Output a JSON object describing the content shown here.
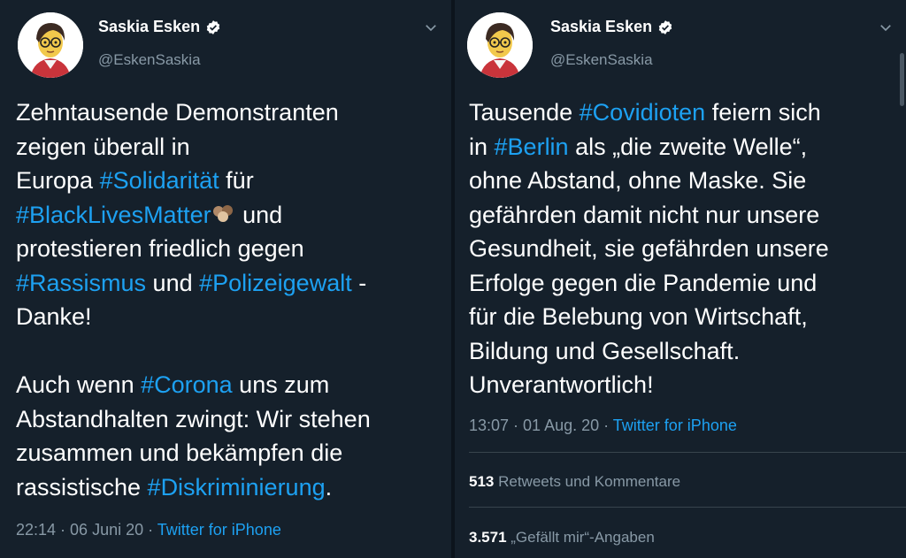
{
  "left_tweet": {
    "author": {
      "name": "Saskia Esken",
      "handle": "@EskenSaskia"
    },
    "lines": [
      {
        "segments": [
          {
            "text": "Zehntausende Demonstranten",
            "tag": false
          }
        ]
      },
      {
        "segments": [
          {
            "text": "zeigen überall in",
            "tag": false
          }
        ]
      },
      {
        "segments": [
          {
            "text": "Europa ",
            "tag": false
          },
          {
            "text": "#Solidarität",
            "tag": true
          },
          {
            "text": " für",
            "tag": false
          }
        ]
      },
      {
        "segments": [
          {
            "text": "#BlackLivesMatter",
            "tag": true
          },
          {
            "text": "__EMOJI__",
            "tag": false
          },
          {
            "text": " und",
            "tag": false
          }
        ]
      },
      {
        "segments": [
          {
            "text": "protestieren friedlich gegen",
            "tag": false
          }
        ]
      },
      {
        "segments": [
          {
            "text": "#Rassismus",
            "tag": true
          },
          {
            "text": " und ",
            "tag": false
          },
          {
            "text": "#Polizeigewalt",
            "tag": true
          },
          {
            "text": " -",
            "tag": false
          }
        ]
      },
      {
        "segments": [
          {
            "text": "Danke!",
            "tag": false
          }
        ]
      },
      {
        "segments": [
          {
            "text": "",
            "tag": false
          }
        ]
      },
      {
        "segments": [
          {
            "text": "Auch wenn ",
            "tag": false
          },
          {
            "text": "#Corona",
            "tag": true
          },
          {
            "text": " uns zum",
            "tag": false
          }
        ]
      },
      {
        "segments": [
          {
            "text": "Abstandhalten zwingt: Wir stehen",
            "tag": false
          }
        ]
      },
      {
        "segments": [
          {
            "text": "zusammen und bekämpfen die",
            "tag": false
          }
        ]
      },
      {
        "segments": [
          {
            "text": "rassistische ",
            "tag": false
          },
          {
            "text": "#Diskriminierung",
            "tag": true
          },
          {
            "text": ".",
            "tag": false
          }
        ]
      }
    ],
    "emoji_name": "raised-fists-emoji",
    "timestamp": "22:14 · 06 Juni 20 · ",
    "source": "Twitter for iPhone"
  },
  "right_tweet": {
    "author": {
      "name": "Saskia Esken",
      "handle": "@EskenSaskia"
    },
    "lines": [
      {
        "segments": [
          {
            "text": "Tausende ",
            "tag": false
          },
          {
            "text": "#Covidioten",
            "tag": true
          },
          {
            "text": " feiern sich",
            "tag": false
          }
        ]
      },
      {
        "segments": [
          {
            "text": "in ",
            "tag": false
          },
          {
            "text": "#Berlin",
            "tag": true
          },
          {
            "text": " als „die zweite Welle“,",
            "tag": false
          }
        ]
      },
      {
        "segments": [
          {
            "text": "ohne Abstand, ohne Maske. Sie",
            "tag": false
          }
        ]
      },
      {
        "segments": [
          {
            "text": "gefährden damit nicht nur unsere",
            "tag": false
          }
        ]
      },
      {
        "segments": [
          {
            "text": "Gesundheit, sie gefährden unsere",
            "tag": false
          }
        ]
      },
      {
        "segments": [
          {
            "text": "Erfolge gegen die Pandemie und",
            "tag": false
          }
        ]
      },
      {
        "segments": [
          {
            "text": "für die Belebung von Wirtschaft,",
            "tag": false
          }
        ]
      },
      {
        "segments": [
          {
            "text": "Bildung und Gesellschaft.",
            "tag": false
          }
        ]
      },
      {
        "segments": [
          {
            "text": "Unverantwortlich!",
            "tag": false
          }
        ]
      }
    ],
    "timestamp": "13:07 · 01 Aug. 20 · ",
    "source": "Twitter for iPhone",
    "retweets_count": "513",
    "retweets_label": " Retweets und Kommentare",
    "likes_count": "3.571",
    "likes_label": " „Gefällt mir“-Angaben"
  },
  "colors": {
    "background": "#15202b",
    "hashtag": "#1da1f2",
    "muted": "#8899a6",
    "text": "#ffffff"
  },
  "icons": {
    "verified": "verified-badge-icon",
    "more": "chevron-down-icon",
    "avatar": "avatar"
  }
}
